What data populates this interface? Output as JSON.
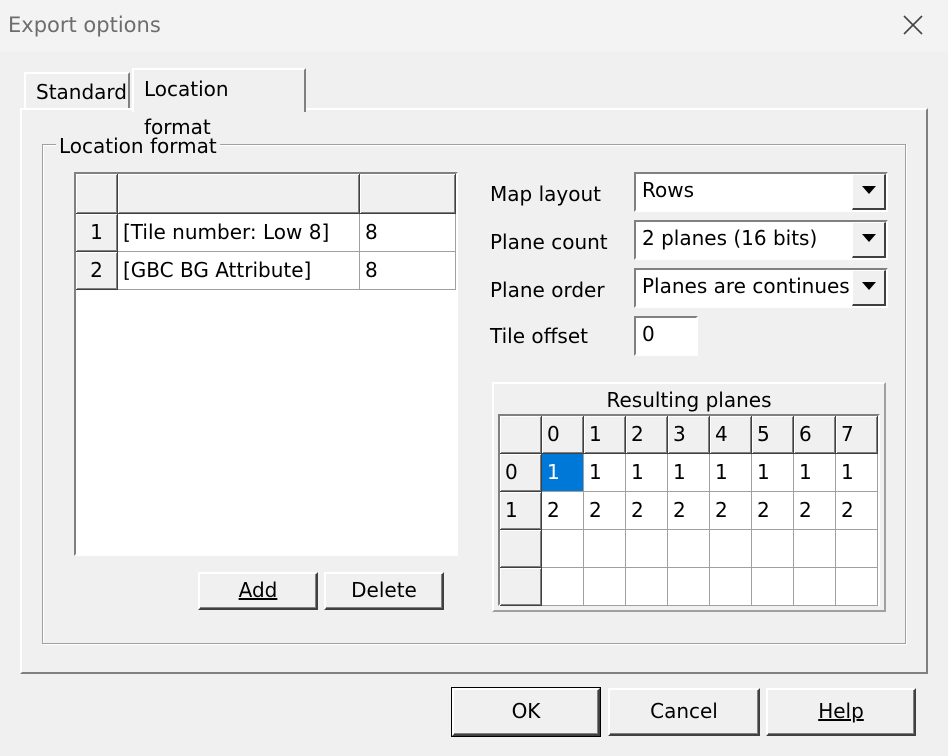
{
  "window": {
    "title": "Export options"
  },
  "tabs": [
    {
      "label": "Standard",
      "active": false
    },
    {
      "label": "Location format",
      "active": true
    }
  ],
  "group": {
    "legend": "Location format"
  },
  "format_table": {
    "headers": [
      "",
      "",
      ""
    ],
    "rows": [
      {
        "index": "1",
        "name": "[Tile number: Low 8]",
        "bits": "8"
      },
      {
        "index": "2",
        "name": "[GBC BG Attribute]",
        "bits": "8"
      }
    ]
  },
  "buttons": {
    "add": "Add",
    "delete": "Delete",
    "ok": "OK",
    "cancel": "Cancel",
    "help": "Help"
  },
  "fields": {
    "map_layout": {
      "label": "Map layout",
      "value": "Rows"
    },
    "plane_count": {
      "label": "Plane count",
      "value": "2 planes (16 bits)"
    },
    "plane_order": {
      "label": "Plane order",
      "value": "Planes are continues"
    },
    "tile_offset": {
      "label": "Tile offset",
      "value": "0"
    }
  },
  "resulting_planes": {
    "title": "Resulting planes",
    "columns": [
      "0",
      "1",
      "2",
      "3",
      "4",
      "5",
      "6",
      "7"
    ],
    "rows": [
      {
        "label": "0",
        "cells": [
          "1",
          "1",
          "1",
          "1",
          "1",
          "1",
          "1",
          "1"
        ]
      },
      {
        "label": "1",
        "cells": [
          "2",
          "2",
          "2",
          "2",
          "2",
          "2",
          "2",
          "2"
        ]
      },
      {
        "label": "",
        "cells": [
          "",
          "",
          "",
          "",
          "",
          "",
          "",
          ""
        ]
      },
      {
        "label": "",
        "cells": [
          "",
          "",
          "",
          "",
          "",
          "",
          "",
          ""
        ]
      }
    ],
    "selected": {
      "row": 0,
      "col": 0
    }
  },
  "colors": {
    "selection": "#0078d7",
    "face": "#f0f0f0",
    "title_text": "#6d6d6d"
  },
  "icons": {
    "close": "close-icon",
    "dropdown": "chevron-down-icon"
  }
}
